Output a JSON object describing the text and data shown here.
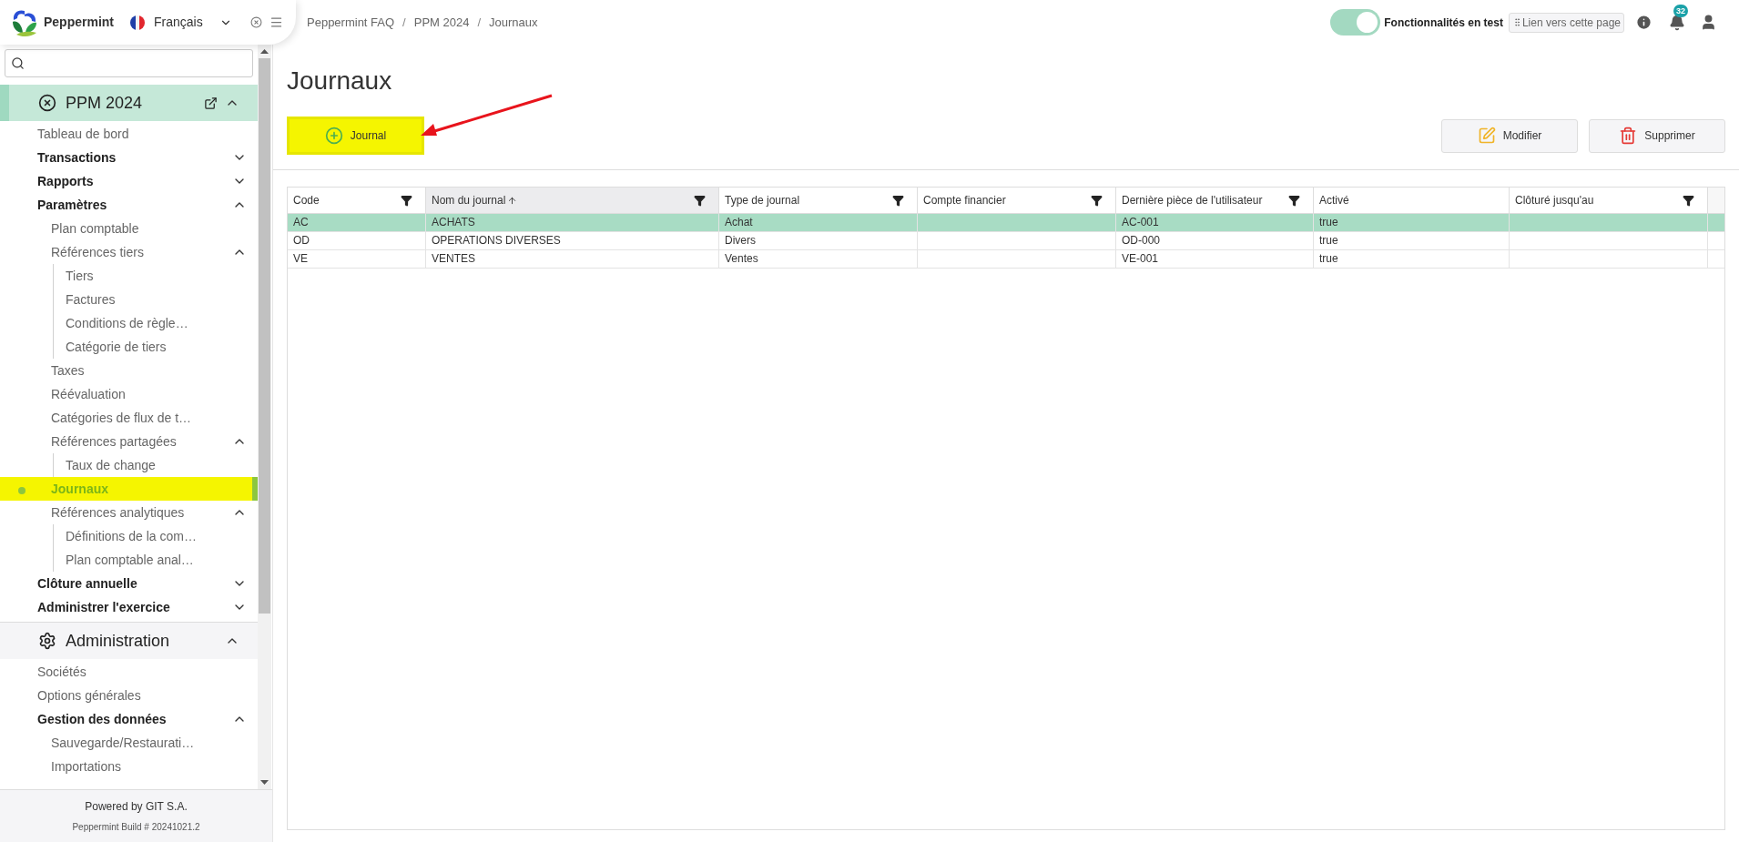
{
  "app": {
    "name": "Peppermint",
    "language": "Français"
  },
  "breadcrumb": [
    {
      "kind": "link",
      "text": "Peppermint FAQ"
    },
    {
      "kind": "separator",
      "text": "/"
    },
    {
      "kind": "link",
      "text": "PPM 2024"
    },
    {
      "kind": "separator",
      "text": "/"
    },
    {
      "kind": "link",
      "text": "Journaux"
    }
  ],
  "topbar": {
    "toggle": {
      "label": "Fonctionnalités en test",
      "on": true
    },
    "link_button": "Lien vers cette page",
    "notifications": "32"
  },
  "sidebar": {
    "sections": [
      {
        "label": "PPM 2024",
        "selected": true,
        "expanded": true,
        "children": [
          {
            "label": "Tableau de bord",
            "selected": false
          },
          {
            "label": "Transactions",
            "selected": false,
            "expanded": false
          },
          {
            "label": "Rapports",
            "selected": false,
            "expanded": false
          },
          {
            "label": "Paramètres",
            "selected": false,
            "expanded": true,
            "children": [
              {
                "label": "Plan comptable",
                "selected": false
              },
              {
                "label": "Références tiers",
                "selected": false,
                "expanded": true,
                "children": [
                  {
                    "label": "Tiers",
                    "selected": false
                  },
                  {
                    "label": "Factures",
                    "selected": false
                  },
                  {
                    "label": "Conditions de règle…",
                    "selected": false
                  },
                  {
                    "label": "Catégorie de tiers",
                    "selected": false
                  }
                ]
              },
              {
                "label": "Taxes",
                "selected": false
              },
              {
                "label": "Réévaluation",
                "selected": false
              },
              {
                "label": "Catégories de flux de t…",
                "selected": false
              },
              {
                "label": "Références partagées",
                "selected": false,
                "expanded": true,
                "children": [
                  {
                    "label": "Taux de change",
                    "selected": false
                  }
                ]
              },
              {
                "label": "Journaux",
                "selected": true
              },
              {
                "label": "Références analytiques",
                "selected": false,
                "expanded": true,
                "children": [
                  {
                    "label": "Définitions de la com…",
                    "selected": false
                  },
                  {
                    "label": "Plan comptable anal…",
                    "selected": false
                  }
                ]
              }
            ]
          },
          {
            "label": "Clôture annuelle",
            "selected": false,
            "expanded": false
          },
          {
            "label": "Administrer l'exercice",
            "selected": false,
            "expanded": false
          }
        ]
      },
      {
        "label": "Administration",
        "selected": false,
        "expanded": true,
        "children": [
          {
            "label": "Sociétés",
            "selected": false
          },
          {
            "label": "Options générales",
            "selected": false
          },
          {
            "label": "Gestion des données",
            "selected": false,
            "expanded": true,
            "children": [
              {
                "label": "Sauvegarde/Restaurati…",
                "selected": false
              },
              {
                "label": "Importations",
                "selected": false
              }
            ]
          }
        ]
      }
    ],
    "footer": {
      "powered": "Powered by GIT S.A.",
      "build": "Peppermint Build # 20241021.2"
    }
  },
  "page": {
    "title": "Journaux",
    "add_button": {
      "label": "Journal",
      "highlighted": true
    },
    "actions": [
      "Modifier",
      "Supprimer"
    ]
  },
  "table": {
    "columns": [
      {
        "label": "Code",
        "filter": true,
        "sorted_ascending": false
      },
      {
        "label": "Nom du journal",
        "filter": true,
        "sorted_ascending": true
      },
      {
        "label": "Type de journal",
        "filter": true,
        "sorted_ascending": false
      },
      {
        "label": "Compte financier",
        "filter": true,
        "sorted_ascending": false
      },
      {
        "label": "Dernière pièce de l'utilisateur",
        "filter": true,
        "sorted_ascending": false
      },
      {
        "label": "Activé",
        "filter": false,
        "sorted_ascending": false
      },
      {
        "label": "Clôturé jusqu'au",
        "filter": true,
        "sorted_ascending": false
      }
    ],
    "rows": [
      {
        "selected": true,
        "cells": [
          "AC",
          "ACHATS",
          "Achat",
          "",
          "AC-001",
          "true",
          ""
        ]
      },
      {
        "selected": false,
        "cells": [
          "OD",
          "OPERATIONS DIVERSES",
          "Divers",
          "",
          "OD-000",
          "true",
          ""
        ]
      },
      {
        "selected": false,
        "cells": [
          "VE",
          "VENTES",
          "Ventes",
          "",
          "VE-001",
          "true",
          ""
        ]
      }
    ]
  }
}
